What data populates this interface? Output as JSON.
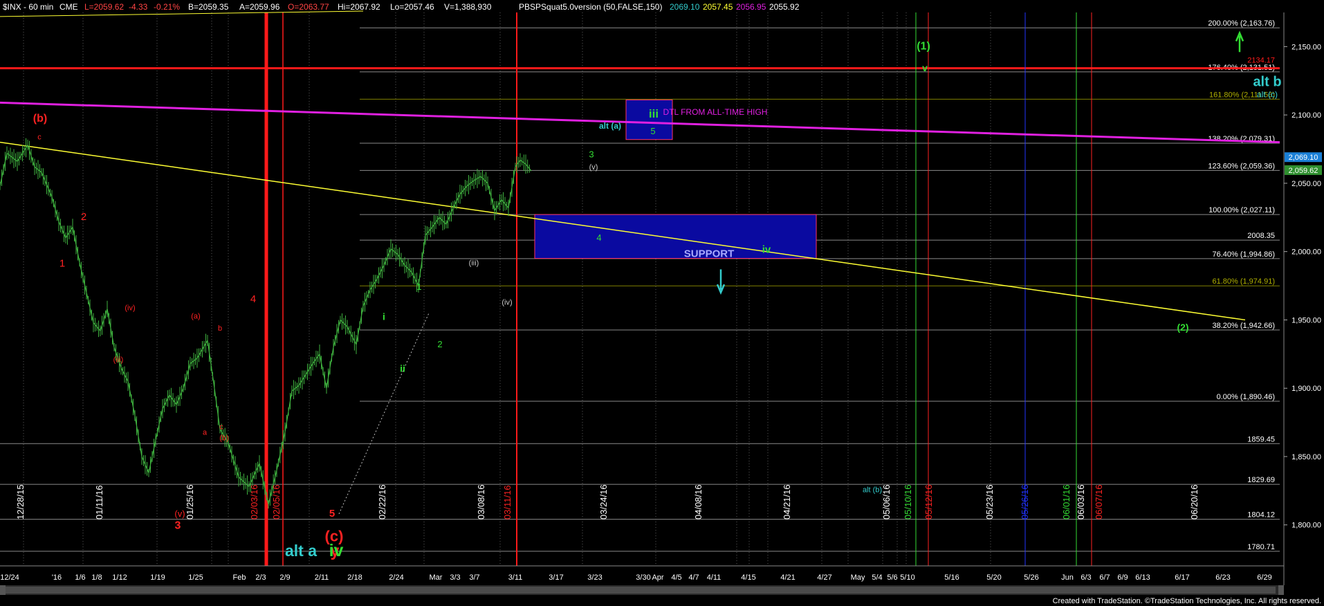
{
  "header": {
    "symbol": "$INX - 60 min",
    "exchange": "CME",
    "last": "L=2059.62",
    "change": "-4.33",
    "change_pct": "-0.21%",
    "bid": "B=2059.35",
    "ask": "A=2059.96",
    "open": "O=2063.77",
    "high": "Hi=2067.92",
    "low": "Lo=2057.46",
    "volume": "V=1,388,930",
    "indicator": "PBSPSquat5.0version (50,FALSE,150)",
    "ind_vals": [
      "2069.10",
      "2057.45",
      "2056.95",
      "2055.92"
    ]
  },
  "footer": "Created with TradeStation. ©TradeStation Technologies, Inc. All rights reserved.",
  "colors": {
    "background": "#000000",
    "candle": "#3fb23f",
    "fib_line": "#8a8a8a",
    "yellow_trend": "#ffff33",
    "magenta_trend": "#e020e0",
    "red_line": "#ff1a1a",
    "support_box": "#0a0aa0",
    "green_label": "#33dd33",
    "red_label": "#ff2222",
    "cyan_label": "#33cccc",
    "axis_text": "#ffffff"
  },
  "chart_data": {
    "type": "candlestick",
    "ylim": [
      1770,
      2175
    ],
    "y_ticks": [
      1800,
      1850,
      1900,
      1950,
      2000,
      2050,
      2100,
      2150
    ],
    "y_tick_labels": [
      "1,800.00",
      "1,850.00",
      "1,900.00",
      "1,950.00",
      "2,000.00",
      "2,050.00",
      "2,100.00",
      "2,150.00"
    ],
    "price_series": [
      [
        0,
        2048
      ],
      [
        10,
        2072
      ],
      [
        25,
        2066
      ],
      [
        40,
        2078
      ],
      [
        50,
        2062
      ],
      [
        60,
        2058
      ],
      [
        75,
        2040
      ],
      [
        85,
        2022
      ],
      [
        95,
        2010
      ],
      [
        105,
        2018
      ],
      [
        115,
        1992
      ],
      [
        125,
        1970
      ],
      [
        135,
        1948
      ],
      [
        145,
        1942
      ],
      [
        155,
        1958
      ],
      [
        165,
        1930
      ],
      [
        175,
        1915
      ],
      [
        185,
        1905
      ],
      [
        195,
        1880
      ],
      [
        205,
        1850
      ],
      [
        215,
        1838
      ],
      [
        225,
        1862
      ],
      [
        235,
        1885
      ],
      [
        245,
        1895
      ],
      [
        255,
        1888
      ],
      [
        265,
        1900
      ],
      [
        275,
        1918
      ],
      [
        285,
        1922
      ],
      [
        300,
        1935
      ],
      [
        310,
        1900
      ],
      [
        318,
        1870
      ],
      [
        330,
        1860
      ],
      [
        345,
        1835
      ],
      [
        360,
        1828
      ],
      [
        375,
        1845
      ],
      [
        388,
        1815
      ],
      [
        400,
        1840
      ],
      [
        412,
        1868
      ],
      [
        422,
        1898
      ],
      [
        432,
        1902
      ],
      [
        442,
        1910
      ],
      [
        452,
        1918
      ],
      [
        462,
        1925
      ],
      [
        472,
        1900
      ],
      [
        482,
        1930
      ],
      [
        492,
        1950
      ],
      [
        502,
        1945
      ],
      [
        515,
        1932
      ],
      [
        525,
        1960
      ],
      [
        535,
        1972
      ],
      [
        545,
        1980
      ],
      [
        555,
        1990
      ],
      [
        565,
        2002
      ],
      [
        575,
        1998
      ],
      [
        585,
        1990
      ],
      [
        595,
        1985
      ],
      [
        605,
        1975
      ],
      [
        615,
        2012
      ],
      [
        625,
        2018
      ],
      [
        635,
        2025
      ],
      [
        645,
        2020
      ],
      [
        655,
        2032
      ],
      [
        665,
        2042
      ],
      [
        675,
        2048
      ],
      [
        685,
        2052
      ],
      [
        695,
        2055
      ],
      [
        705,
        2050
      ],
      [
        715,
        2030
      ],
      [
        725,
        2038
      ],
      [
        735,
        2032
      ],
      [
        745,
        2062
      ],
      [
        752,
        2067
      ],
      [
        760,
        2064
      ],
      [
        768,
        2059
      ]
    ],
    "fib_levels": [
      {
        "label": "200.00% (2,163.76)",
        "value": 2163.76
      },
      {
        "label": "176.40% (2,131.51)",
        "value": 2131.51
      },
      {
        "label": "161.80% (2,111.56)",
        "value": 2111.56
      },
      {
        "label": "138.20% (2,079.31)",
        "value": 2079.31
      },
      {
        "label": "123.60% (2,059.36)",
        "value": 2059.36
      },
      {
        "label": "100.00% (2,027.11)",
        "value": 2027.11
      },
      {
        "label": "2008.35",
        "value": 2008.35
      },
      {
        "label": "76.40% (1,994.86)",
        "value": 1994.86
      },
      {
        "label": "61.80% (1,974.91)",
        "value": 1974.91
      },
      {
        "label": "38.20% (1,942.66)",
        "value": 1942.66
      },
      {
        "label": "0.00% (1,890.46)",
        "value": 1890.46
      },
      {
        "label": "1859.45",
        "value": 1859.45
      },
      {
        "label": "1829.69",
        "value": 1829.69
      },
      {
        "label": "1804.12",
        "value": 1804.12
      },
      {
        "label": "1780.71",
        "value": 1780.71
      }
    ],
    "horizontal_red": {
      "label": "2134.17",
      "value": 2134.17
    },
    "price_tags": [
      "2,069.10",
      "2,059.62"
    ],
    "x_ticks": [
      "12/24",
      "'16",
      "1/6",
      "1/8",
      "1/12",
      "1/19",
      "1/25",
      "Feb",
      "2/3",
      "2/9",
      "2/11",
      "2/18",
      "2/24",
      "Mar",
      "3/3",
      "3/7",
      "3/11",
      "3/17",
      "3/23",
      "3/30",
      "Apr",
      "4/5",
      "4/7",
      "4/11",
      "4/15",
      "4/21",
      "4/27",
      "May",
      "5/4",
      "5/6",
      "5/10",
      "5/16",
      "5/20",
      "5/26",
      "Jun",
      "6/3",
      "6/7",
      "6/9",
      "6/13",
      "6/17",
      "6/23",
      "6/29"
    ],
    "date_labels": [
      {
        "text": "12/28/15",
        "color": "#ffffff"
      },
      {
        "text": "01/11/16",
        "color": "#ffffff"
      },
      {
        "text": "01/25/16",
        "color": "#ffffff"
      },
      {
        "text": "02/03/16",
        "color": "#ff2222"
      },
      {
        "text": "02/05/16",
        "color": "#ff2222"
      },
      {
        "text": "02/22/16",
        "color": "#ffffff"
      },
      {
        "text": "03/08/16",
        "color": "#ffffff"
      },
      {
        "text": "03/11/16",
        "color": "#ff2222"
      },
      {
        "text": "03/24/16",
        "color": "#ffffff"
      },
      {
        "text": "04/08/16",
        "color": "#ffffff"
      },
      {
        "text": "04/21/16",
        "color": "#ffffff"
      },
      {
        "text": "05/06/16",
        "color": "#ffffff"
      },
      {
        "text": "05/10/16",
        "color": "#33dd33"
      },
      {
        "text": "05/12/16",
        "color": "#ff2222"
      },
      {
        "text": "05/23/16",
        "color": "#ffffff"
      },
      {
        "text": "05/26/16",
        "color": "#2233ff"
      },
      {
        "text": "06/01/16",
        "color": "#33dd33"
      },
      {
        "text": "06/03/16",
        "color": "#ffffff"
      },
      {
        "text": "06/07/16",
        "color": "#ff2222"
      },
      {
        "text": "06/20/16",
        "color": "#ffffff"
      }
    ],
    "annotations": [
      {
        "text": "(b)",
        "color": "#ff2222"
      },
      {
        "text": "c",
        "color": "#ff2222"
      },
      {
        "text": "1",
        "color": "#ff2222"
      },
      {
        "text": "2",
        "color": "#ff2222"
      },
      {
        "text": "(iv)",
        "color": "#ff2222"
      },
      {
        "text": "(iii)",
        "color": "#ff2222"
      },
      {
        "text": "(v)",
        "color": "#ff2222"
      },
      {
        "text": "3",
        "color": "#ff2222"
      },
      {
        "text": "(a)",
        "color": "#ff2222"
      },
      {
        "text": "b",
        "color": "#ff2222"
      },
      {
        "text": "a",
        "color": "#ff2222"
      },
      {
        "text": "c",
        "color": "#ff2222"
      },
      {
        "text": "(b)",
        "color": "#ff2222"
      },
      {
        "text": "4",
        "color": "#ff2222"
      },
      {
        "text": "5",
        "color": "#ff2222"
      },
      {
        "text": "(c)",
        "color": "#ff2222"
      },
      {
        "text": "y",
        "color": "#ff2222"
      },
      {
        "text": "alt a",
        "color": "#33cccc"
      },
      {
        "text": "iv",
        "color": "#33dd33"
      },
      {
        "text": "i",
        "color": "#33dd33"
      },
      {
        "text": "ii",
        "color": "#33dd33"
      },
      {
        "text": "1",
        "color": "#33dd33"
      },
      {
        "text": "2",
        "color": "#33dd33"
      },
      {
        "text": "(iii)",
        "color": "#cccccc"
      },
      {
        "text": "(iv)",
        "color": "#cccccc"
      },
      {
        "text": "3",
        "color": "#33dd33"
      },
      {
        "text": "(v)",
        "color": "#cccccc"
      },
      {
        "text": "4",
        "color": "#33dd33"
      },
      {
        "text": "alt (a)",
        "color": "#33cccc"
      },
      {
        "text": "iii",
        "color": "#33dd33"
      },
      {
        "text": "5",
        "color": "#33dd33"
      },
      {
        "text": "DTL FROM ALL-TIME HIGH",
        "color": "#e020e0"
      },
      {
        "text": "SUPPORT",
        "color": "#aaaaff"
      },
      {
        "text": "iv",
        "color": "#33dd33"
      },
      {
        "text": "(1)",
        "color": "#33dd33"
      },
      {
        "text": "v",
        "color": "#33dd33"
      },
      {
        "text": "(2)",
        "color": "#33dd33"
      },
      {
        "text": "alt b",
        "color": "#33cccc"
      },
      {
        "text": "alt (c)",
        "color": "#33cccc"
      },
      {
        "text": "alt (b)",
        "color": "#33cccc"
      }
    ]
  }
}
